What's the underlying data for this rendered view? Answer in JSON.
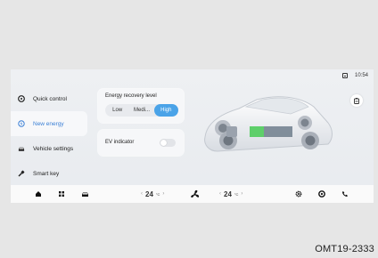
{
  "status": {
    "time": "10:54",
    "battery_icon": "battery-icon"
  },
  "sidebar": {
    "items": [
      {
        "label": "Quick control",
        "icon": "steering-wheel-icon",
        "active": false
      },
      {
        "label": "New energy",
        "icon": "energy-icon",
        "active": true
      },
      {
        "label": "Vehicle settings",
        "icon": "car-icon",
        "active": false
      },
      {
        "label": "Smart key",
        "icon": "key-icon",
        "active": false
      }
    ]
  },
  "energy_recovery": {
    "title": "Energy recovery level",
    "options": [
      "Low",
      "Medi...",
      "High"
    ],
    "selected": "High"
  },
  "ev_indicator": {
    "label": "EV indicator",
    "enabled": false
  },
  "dock": {
    "left_temp": {
      "value": "24",
      "unit": "°C"
    },
    "right_temp": {
      "value": "24",
      "unit": "°C"
    },
    "left_icons": [
      "home-icon",
      "apps-icon",
      "car-icon"
    ],
    "center_icon": "fan-icon",
    "right_icons": [
      "settings-icon",
      "camera-icon",
      "phone-icon"
    ]
  },
  "colors": {
    "accent": "#4aa3e8",
    "active_nav": "#3a7fd5"
  },
  "caption": "OMT19-2333"
}
